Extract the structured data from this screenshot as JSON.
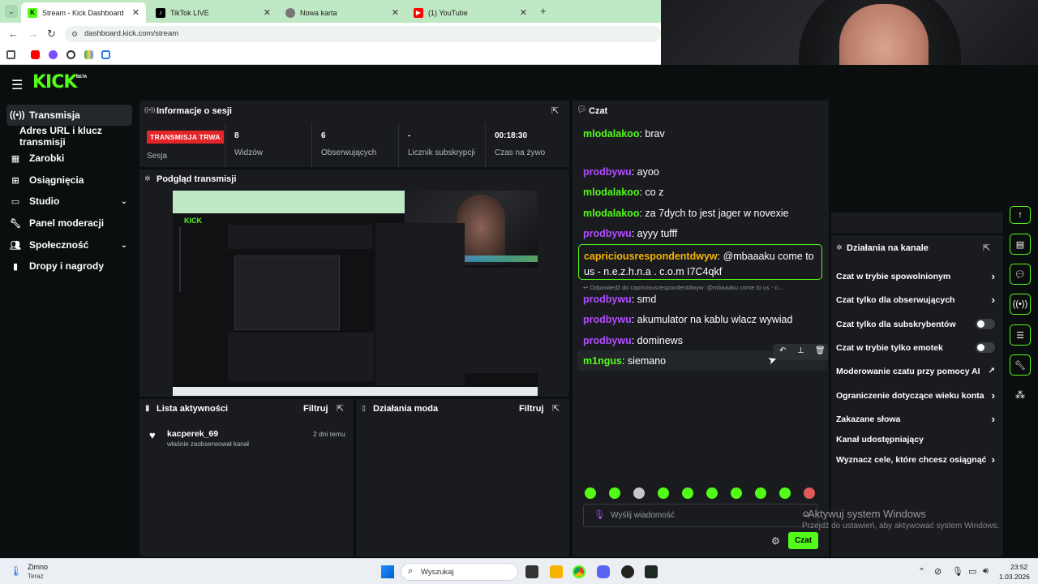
{
  "browser": {
    "tabs": [
      {
        "title": "Stream - Kick Dashboard",
        "active": true,
        "icon": "kick-icon"
      },
      {
        "title": "TikTok LIVE",
        "active": false,
        "icon": "tiktok-icon"
      },
      {
        "title": "Nowa karta",
        "active": false,
        "icon": "newtab-icon"
      },
      {
        "title": "(1) YouTube",
        "active": false,
        "icon": "youtube-icon"
      }
    ],
    "url": "dashboard.kick.com/stream"
  },
  "sidebar": {
    "items": [
      {
        "label": "Transmisja",
        "icon": "broadcast-icon"
      },
      {
        "label": "Adres URL i klucz transmisji",
        "icon": ""
      },
      {
        "label": "Zarobki",
        "icon": "earnings-icon"
      },
      {
        "label": "Osiągnięcia",
        "icon": "achievements-icon"
      },
      {
        "label": "Studio",
        "icon": "studio-icon"
      },
      {
        "label": "Panel moderacji",
        "icon": "wrench-icon"
      },
      {
        "label": "Społeczność",
        "icon": "community-icon"
      },
      {
        "label": "Dropy i nagrody",
        "icon": "drops-icon"
      }
    ]
  },
  "session": {
    "title": "Informacje o sesji",
    "live_badge": "TRANSMISJA TRWA",
    "session_label": "Sesja",
    "stats": [
      {
        "value": "8",
        "label": "Widzów"
      },
      {
        "value": "6",
        "label": "Obserwujących"
      },
      {
        "value": "-",
        "label": "Licznik subskrypcji"
      },
      {
        "value": "00:18:30",
        "label": "Czas na żywo"
      }
    ]
  },
  "preview": {
    "title": "Podgląd transmisji"
  },
  "activity": {
    "title": "Lista aktywności",
    "filter": "Filtruj",
    "items": [
      {
        "user": "kacperek_69",
        "text": "właśnie zaobserwował kanał",
        "time": "2 dni temu"
      }
    ]
  },
  "mod_actions": {
    "title": "Działania moda",
    "filter": "Filtruj"
  },
  "chat": {
    "title": "Czat",
    "messages": [
      {
        "user": "mlodalakoo",
        "color": "#53fc18",
        "text": "brav"
      },
      {
        "user": "prodbywu",
        "color": "#b44dff",
        "text": "ayoo"
      },
      {
        "user": "mlodalakoo",
        "color": "#53fc18",
        "text": "co z"
      },
      {
        "user": "mlodalakoo",
        "color": "#53fc18",
        "text": "za 7dych to jest jager w novexie"
      },
      {
        "user": "prodbywu",
        "color": "#b44dff",
        "text": "ayyy tufff"
      },
      {
        "user": "capriciousrespondentdwyw",
        "color": "#f5b400",
        "text": "@mbaaaku come to us - n.e.z.h.n.a . c.o.m I7C4qkf"
      },
      {
        "user": "prodbywu",
        "color": "#b44dff",
        "text": "smd"
      },
      {
        "user": "prodbywu",
        "color": "#b44dff",
        "text": "akumulator na kablu wlacz wywiad"
      },
      {
        "user": "prodbywu",
        "color": "#b44dff",
        "text": "dominews"
      },
      {
        "user": "m1ngus",
        "color": "#53fc18",
        "text": "siemano"
      }
    ],
    "reply_note": "Odpowiedź do capriciousrespondentdwyw: @mbaaaku come to us - n...",
    "input_placeholder": "Wyślij wiadomość",
    "send_label": "Czat"
  },
  "channel_actions": {
    "title": "Działania na kanale",
    "rows": [
      {
        "label": "Czat w trybie spowolnionym",
        "control": "arrow"
      },
      {
        "label": "Czat tylko dla obserwujących",
        "control": "arrow"
      },
      {
        "label": "Czat tylko dla subskrybentów",
        "control": "toggle"
      },
      {
        "label": "Czat w trybie tylko emotek",
        "control": "toggle"
      },
      {
        "label": "Moderowanie czatu przy pomocy AI",
        "control": "external"
      },
      {
        "label": "Ograniczenie dotyczące wieku konta",
        "control": "arrow"
      },
      {
        "label": "Zakazane słowa",
        "control": "arrow"
      },
      {
        "label": "Kanał udostępniający",
        "control": "none"
      },
      {
        "label": "Wyznacz cele, które chcesz osiągnąć",
        "control": "arrow"
      }
    ]
  },
  "watermark": {
    "line1": "Aktywuj system Windows",
    "line2": "Przejdź do ustawień, aby aktywować system Windows."
  },
  "taskbar": {
    "weather_title": "Zimno",
    "weather_sub": "Teraz",
    "search_placeholder": "Wyszukaj",
    "time": "23:52",
    "date": "1.03.2026"
  },
  "colors": {
    "accent": "#53fc18",
    "live": "#e3262a",
    "panel": "#191b1f"
  }
}
